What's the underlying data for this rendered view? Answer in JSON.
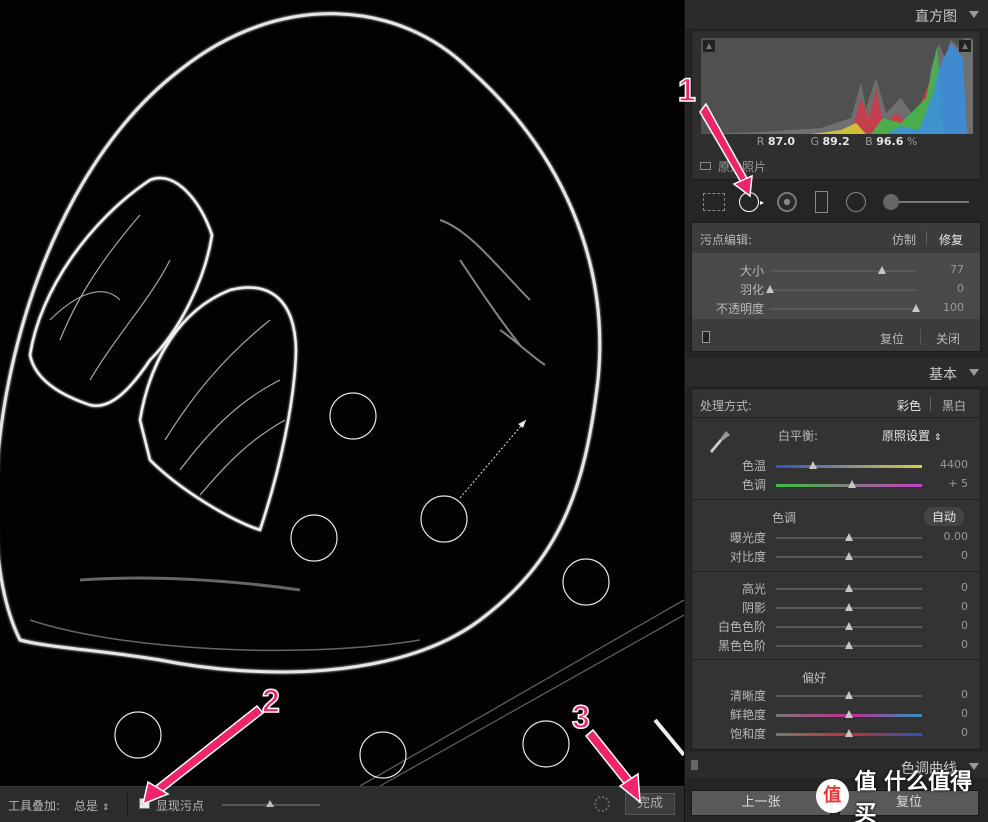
{
  "toolbar": {
    "overlay_label": "工具叠加:",
    "overlay_value": "总是",
    "show_spots_label": "显现污点",
    "done_label": "完成"
  },
  "histogram": {
    "title": "直方图",
    "r_label": "R",
    "r_value": "87.0",
    "g_label": "G",
    "g_value": "89.2",
    "b_label": "B",
    "b_value": "96.6",
    "pct": "%",
    "original_photo_label": "原始照片"
  },
  "spot_edit": {
    "title": "污点编辑:",
    "mode_clone": "仿制",
    "mode_heal": "修复",
    "sliders": [
      {
        "label": "大小",
        "value": "77",
        "level": 0.77
      },
      {
        "label": "羽化",
        "value": "0",
        "level": 0
      },
      {
        "label": "不透明度",
        "value": "100",
        "level": 1
      }
    ],
    "reset_label": "复位",
    "close_label": "关闭"
  },
  "basic": {
    "title": "基本",
    "treatment_label": "处理方式:",
    "treatment_color": "彩色",
    "treatment_bw": "黑白",
    "wb_label": "白平衡:",
    "wb_value": "原照设置",
    "wb_sliders": [
      {
        "label": "色温",
        "value": "4400",
        "level": 0.25
      },
      {
        "label": "色调",
        "value": "+ 5",
        "level": 0.52
      }
    ],
    "tone_title": "色调",
    "auto_label": "自动",
    "tone_sliders": [
      {
        "label": "曝光度",
        "value": "0.00",
        "level": 0.5
      },
      {
        "label": "对比度",
        "value": "0",
        "level": 0.5
      }
    ],
    "light_sliders": [
      {
        "label": "高光",
        "value": "0",
        "level": 0.5
      },
      {
        "label": "阴影",
        "value": "0",
        "level": 0.5
      },
      {
        "label": "白色色阶",
        "value": "0",
        "level": 0.5
      },
      {
        "label": "黑色色阶",
        "value": "0",
        "level": 0.5
      }
    ],
    "presence_title": "偏好",
    "presence_sliders": [
      {
        "label": "清晰度",
        "value": "0",
        "level": 0.5
      },
      {
        "label": "鲜艳度",
        "value": "0",
        "level": 0.5
      },
      {
        "label": "饱和度",
        "value": "0",
        "level": 0.5
      }
    ]
  },
  "tone_curve": {
    "title": "色调曲线"
  },
  "nav": {
    "prev_label": "上一张",
    "next_label": "复位"
  },
  "annotations": [
    "1",
    "2",
    "3"
  ],
  "watermark": "值 什么值得买",
  "colors": {
    "annotation": "#f0246a",
    "panel": "#252525",
    "subpanel": "#3a3a3a"
  }
}
